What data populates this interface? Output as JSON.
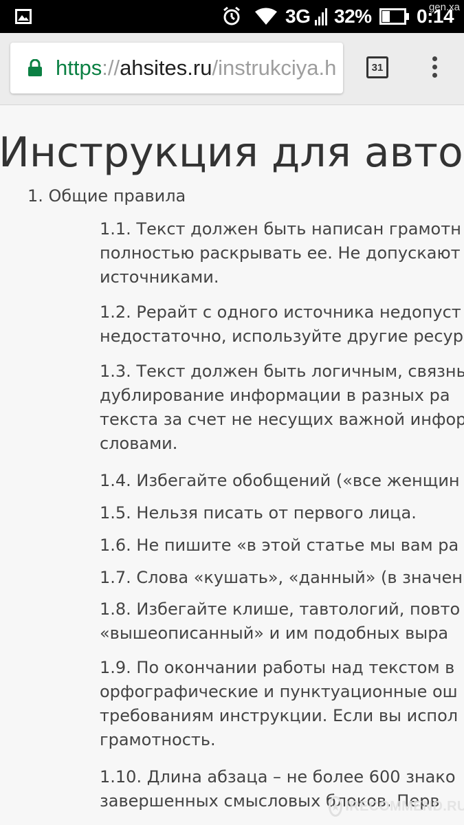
{
  "status_bar": {
    "network": "3G",
    "battery": "32%",
    "time": "0:14",
    "watermark": "gen.xa"
  },
  "browser": {
    "url_scheme": "https",
    "url_separator": "://",
    "url_host": "ahsites.ru",
    "url_path": "/instrukciya.h",
    "tab_count": "31",
    "accent_color": "#0b8043"
  },
  "page": {
    "title": "Инструкция для авторо",
    "section_1": "1. Общие правила",
    "rules": [
      {
        "lines": [
          "1.1. Текст должен быть написан грамотн",
          "полностью раскрывать ее. Не допускают",
          "источниками."
        ]
      },
      {
        "lines": [
          "1.2. Рерайт с одного источника недопуст",
          "недостаточно, используйте другие ресур"
        ]
      },
      {
        "lines": [
          "1.3. Текст должен быть логичным, связны",
          "дублирование информации в разных ра",
          "текста за счет не несущих важной инфор",
          "словами."
        ]
      },
      {
        "lines": [
          "1.4. Избегайте обобщений («все женщин"
        ]
      },
      {
        "lines": [
          "1.5. Нельзя писать от первого лица."
        ]
      },
      {
        "lines": [
          "1.6. Не пишите «в этой статье мы вам ра"
        ]
      },
      {
        "lines": [
          "1.7. Слова «кушать», «данный» (в значен"
        ]
      },
      {
        "lines": [
          "1.8. Избегайте клише, тавтологий, повто",
          "«вышеописанный» и им подобных выра"
        ]
      },
      {
        "lines": [
          "1.9. По окончании работы над текстом в",
          "орфографические и пунктуационные ош",
          "требованиям инструкции. Если вы испол",
          "грамотность."
        ]
      },
      {
        "lines": [
          "1.10. Длина абзаца – не более 600 знако",
          "завершенных смысловых блоков. Перв"
        ]
      }
    ]
  },
  "watermark": {
    "text": "IRECOMMEND.RU"
  }
}
